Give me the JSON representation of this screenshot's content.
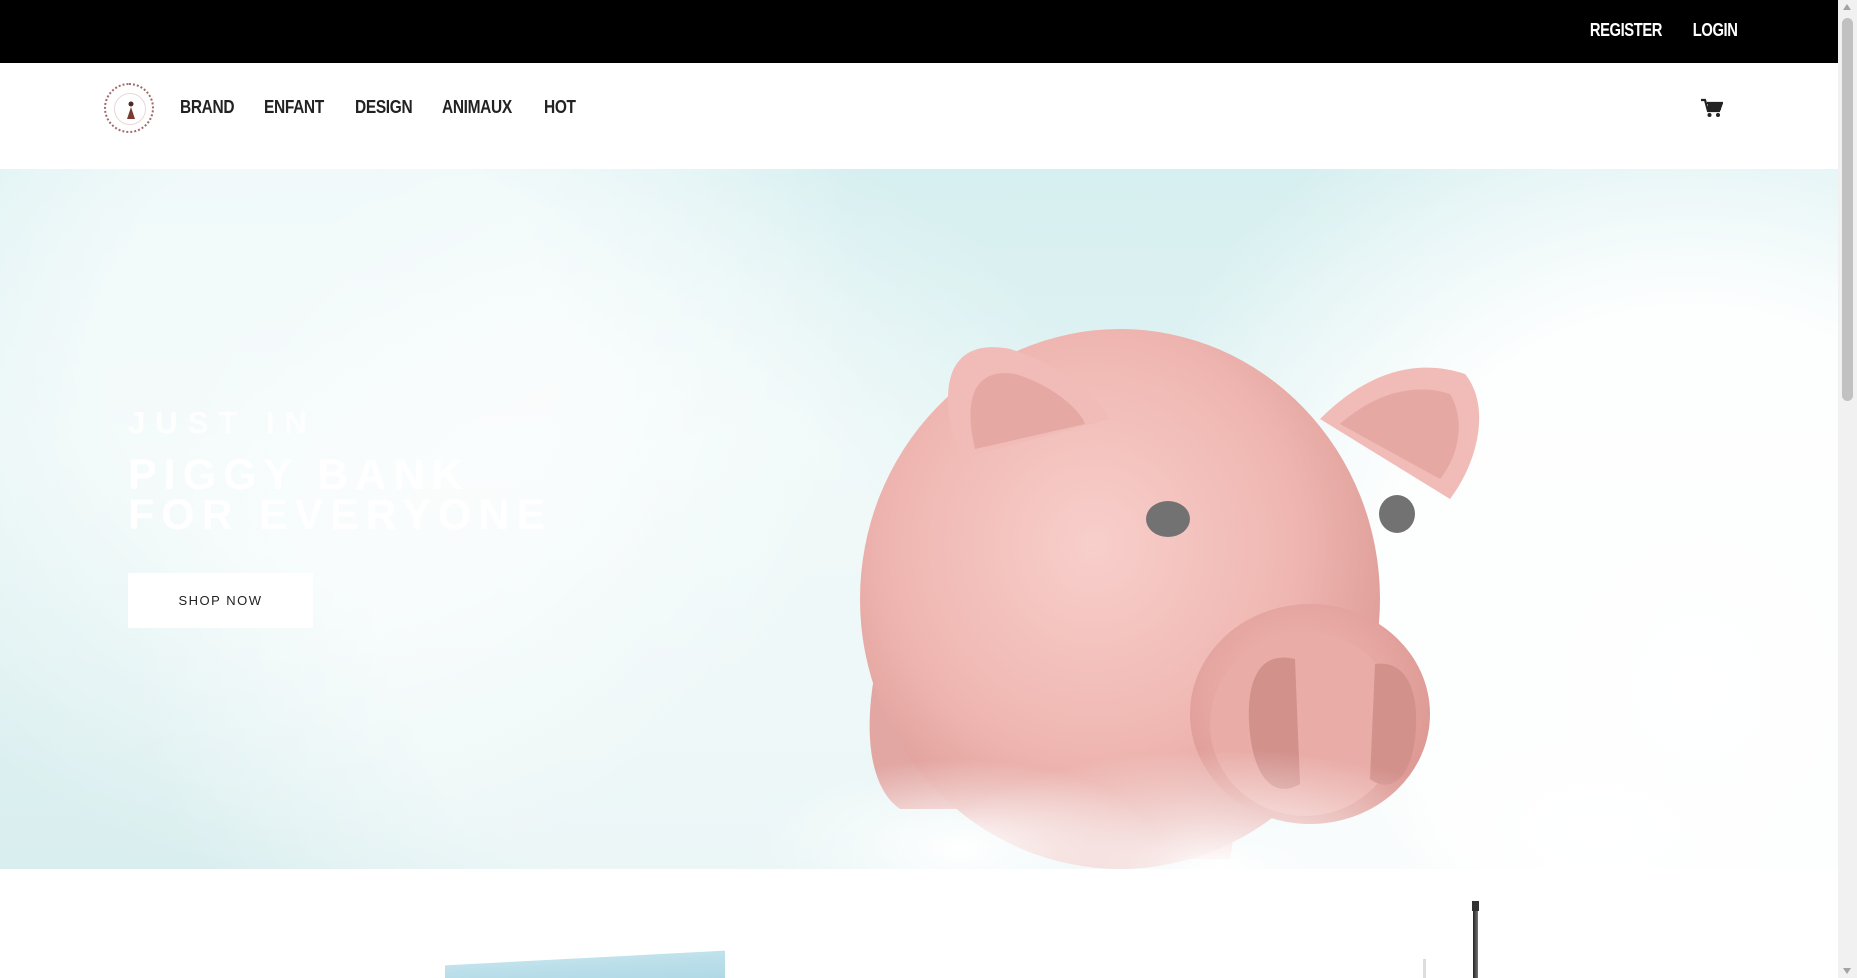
{
  "topbar": {
    "register": "REGISTER",
    "login": "LOGIN"
  },
  "nav": {
    "items": [
      "BRAND",
      "ENFANT",
      "DESIGN",
      "ANIMAUX",
      "HOT"
    ]
  },
  "hero": {
    "eyebrow": "JUST IN",
    "headline_line1": "PIGGY BANK",
    "headline_line2": "FOR EVERYONE",
    "cta": "SHOP NOW"
  },
  "icons": {
    "cart": "shopping-cart-icon",
    "logo": "brand-logo"
  },
  "colors": {
    "topbar": "#000000",
    "hero_sky": "#d9eeef",
    "piggy": "#f0b9b6"
  }
}
